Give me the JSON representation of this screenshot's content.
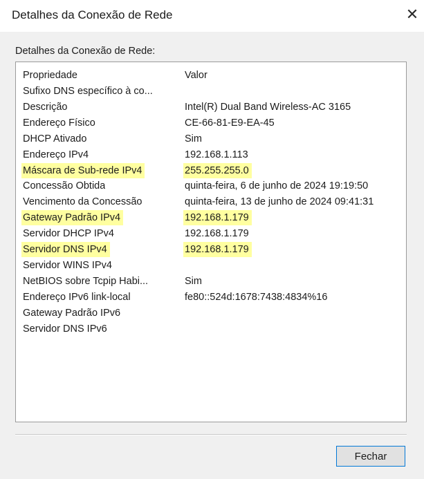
{
  "window": {
    "title": "Detalhes da Conexão de Rede",
    "close_glyph": "✕"
  },
  "group_label": "Detalhes da Conexão de Rede:",
  "columns": {
    "property": "Propriedade",
    "value": "Valor"
  },
  "rows": [
    {
      "property": "Sufixo DNS específico à co...",
      "value": "",
      "highlight_property": false,
      "highlight_value": false
    },
    {
      "property": "Descrição",
      "value": "Intel(R) Dual Band Wireless-AC 3165",
      "highlight_property": false,
      "highlight_value": false
    },
    {
      "property": "Endereço Físico",
      "value": "CE-66-81-E9-EA-45",
      "highlight_property": false,
      "highlight_value": false
    },
    {
      "property": "DHCP Ativado",
      "value": "Sim",
      "highlight_property": false,
      "highlight_value": false
    },
    {
      "property": "Endereço IPv4",
      "value": "192.168.1.113",
      "highlight_property": false,
      "highlight_value": false
    },
    {
      "property": "Máscara de Sub-rede IPv4",
      "value": "255.255.255.0",
      "highlight_property": true,
      "highlight_value": true
    },
    {
      "property": "Concessão Obtida",
      "value": "quinta-feira, 6 de junho de 2024 19:19:50",
      "highlight_property": false,
      "highlight_value": false
    },
    {
      "property": "Vencimento da Concessão",
      "value": "quinta-feira, 13 de junho de 2024 09:41:31",
      "highlight_property": false,
      "highlight_value": false
    },
    {
      "property": "Gateway Padrão IPv4",
      "value": "192.168.1.179",
      "highlight_property": true,
      "highlight_value": true
    },
    {
      "property": "Servidor DHCP IPv4",
      "value": "192.168.1.179",
      "highlight_property": false,
      "highlight_value": false
    },
    {
      "property": "Servidor DNS IPv4",
      "value": "192.168.1.179",
      "highlight_property": true,
      "highlight_value": true
    },
    {
      "property": "Servidor WINS IPv4",
      "value": "",
      "highlight_property": false,
      "highlight_value": false
    },
    {
      "property": "NetBIOS sobre Tcpip Habi...",
      "value": "Sim",
      "highlight_property": false,
      "highlight_value": false
    },
    {
      "property": "Endereço IPv6 link-local",
      "value": "fe80::524d:1678:7438:4834%16",
      "highlight_property": false,
      "highlight_value": false
    },
    {
      "property": "Gateway Padrão IPv6",
      "value": "",
      "highlight_property": false,
      "highlight_value": false
    },
    {
      "property": "Servidor DNS IPv6",
      "value": "",
      "highlight_property": false,
      "highlight_value": false
    }
  ],
  "buttons": {
    "close_label": "Fechar"
  },
  "colors": {
    "highlight": "#ffffa0",
    "accent_border": "#0078d7"
  }
}
